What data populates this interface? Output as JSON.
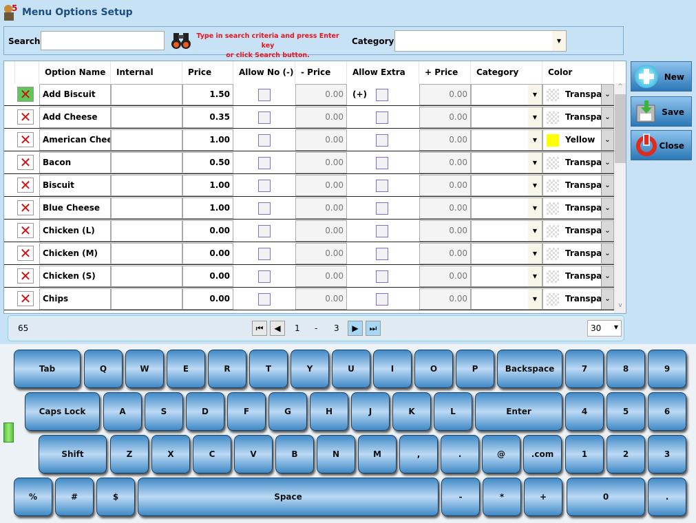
{
  "window": {
    "title": "Menu Options Setup",
    "logo_text": "5"
  },
  "search": {
    "label": "Search",
    "value": "",
    "hint_line1": "Type in search criteria and press Enter key",
    "hint_line2": "or click Search button.",
    "category_label": "Category",
    "category_value": ""
  },
  "grid": {
    "columns": [
      "Option Name",
      "Internal Name",
      "Price",
      "Allow No (-)",
      "- Price",
      "Allow Extra (+)",
      "+ Price",
      "Category",
      "Color"
    ],
    "rows": [
      {
        "name": "Add Biscuit",
        "internal": "",
        "price": "1.50",
        "allow_no": false,
        "minus_price": "0.00",
        "allow_extra": false,
        "plus_price": "0.00",
        "category": "",
        "color": "Transparent",
        "swatch": "transparent"
      },
      {
        "name": "Add Cheese",
        "internal": "",
        "price": "0.35",
        "allow_no": false,
        "minus_price": "0.00",
        "allow_extra": false,
        "plus_price": "0.00",
        "category": "",
        "color": "Transparent",
        "swatch": "transparent"
      },
      {
        "name": "American Cheese",
        "internal": "",
        "price": "1.00",
        "allow_no": false,
        "minus_price": "0.00",
        "allow_extra": false,
        "plus_price": "0.00",
        "category": "",
        "color": "Yellow",
        "swatch": "#ffff00"
      },
      {
        "name": "Bacon",
        "internal": "",
        "price": "0.50",
        "allow_no": false,
        "minus_price": "0.00",
        "allow_extra": false,
        "plus_price": "0.00",
        "category": "",
        "color": "Transparent",
        "swatch": "transparent"
      },
      {
        "name": "Biscuit",
        "internal": "",
        "price": "1.00",
        "allow_no": false,
        "minus_price": "0.00",
        "allow_extra": false,
        "plus_price": "0.00",
        "category": "",
        "color": "Transparent",
        "swatch": "transparent"
      },
      {
        "name": "Blue Cheese",
        "internal": "",
        "price": "1.00",
        "allow_no": false,
        "minus_price": "0.00",
        "allow_extra": false,
        "plus_price": "0.00",
        "category": "",
        "color": "Transparent",
        "swatch": "transparent"
      },
      {
        "name": "Chicken (L)",
        "internal": "",
        "price": "0.00",
        "allow_no": false,
        "minus_price": "0.00",
        "allow_extra": false,
        "plus_price": "0.00",
        "category": "",
        "color": "Transparent",
        "swatch": "transparent"
      },
      {
        "name": "Chicken (M)",
        "internal": "",
        "price": "0.00",
        "allow_no": false,
        "minus_price": "0.00",
        "allow_extra": false,
        "plus_price": "0.00",
        "category": "",
        "color": "Transparent",
        "swatch": "transparent"
      },
      {
        "name": "Chicken (S)",
        "internal": "",
        "price": "0.00",
        "allow_no": false,
        "minus_price": "0.00",
        "allow_extra": false,
        "plus_price": "0.00",
        "category": "",
        "color": "Transparent",
        "swatch": "transparent"
      },
      {
        "name": "Chips",
        "internal": "",
        "price": "0.00",
        "allow_no": false,
        "minus_price": "0.00",
        "allow_extra": false,
        "plus_price": "0.00",
        "category": "",
        "color": "Transparent",
        "swatch": "transparent"
      }
    ]
  },
  "actions": {
    "new": "New",
    "save": "Save",
    "close": "Close"
  },
  "pager": {
    "total": "65",
    "current_page": "1",
    "separator": "-",
    "page_count": "3",
    "page_size": "30"
  },
  "keyboard": {
    "rows": [
      [
        "Tab",
        "Q",
        "W",
        "E",
        "R",
        "T",
        "Y",
        "U",
        "I",
        "O",
        "P",
        "Backspace",
        "7",
        "8",
        "9"
      ],
      [
        "Caps Lock",
        "A",
        "S",
        "D",
        "F",
        "G",
        "H",
        "J",
        "K",
        "L",
        "Enter",
        "4",
        "5",
        "6"
      ],
      [
        "Shift",
        "Z",
        "X",
        "C",
        "V",
        "B",
        "N",
        "M",
        ",",
        ".",
        "@",
        ".com",
        "1",
        "2",
        "3"
      ],
      [
        "%",
        "#",
        "$",
        "Space",
        "-",
        "*",
        "+",
        "0",
        "."
      ]
    ]
  },
  "colors": {
    "background": "#c7e1f5",
    "accent": "#1b4f80",
    "hint": "#e8141e",
    "key": "#3f8ac7"
  }
}
